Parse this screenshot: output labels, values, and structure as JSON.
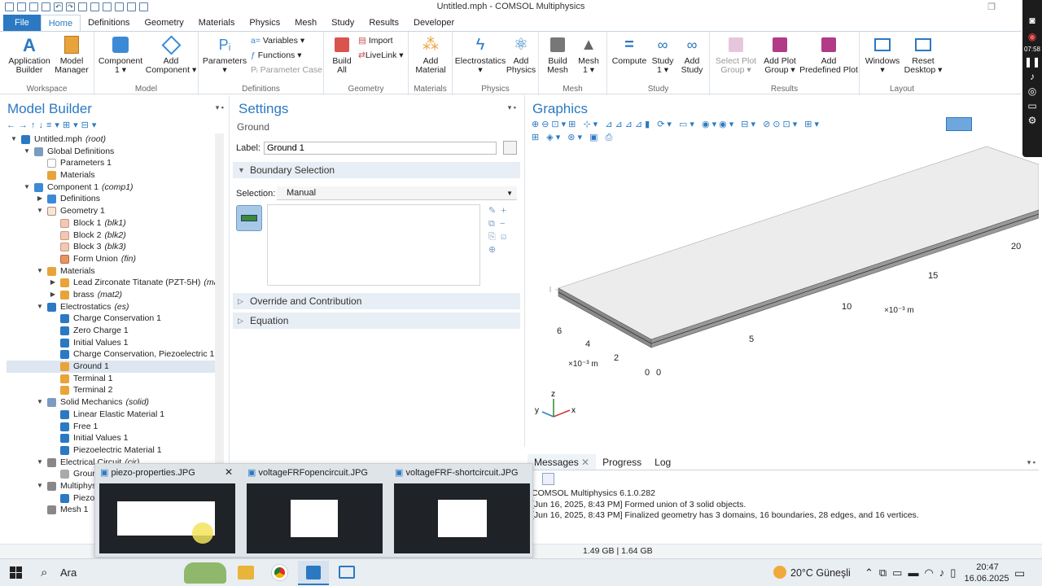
{
  "window": {
    "title": "Untitled.mph - COMSOL Multiphysics"
  },
  "menu": {
    "tabs": [
      "File",
      "Home",
      "Definitions",
      "Geometry",
      "Materials",
      "Physics",
      "Mesh",
      "Study",
      "Results",
      "Developer"
    ]
  },
  "ribbon": {
    "groups": {
      "workspace": "Workspace",
      "model": "Model",
      "definitions": "Definitions",
      "geometry": "Geometry",
      "materials": "Materials",
      "physics": "Physics",
      "mesh": "Mesh",
      "study": "Study",
      "results": "Results",
      "layout": "Layout"
    },
    "buttons": {
      "app_builder_1": "Application",
      "app_builder_2": "Builder",
      "model_manager_1": "Model",
      "model_manager_2": "Manager",
      "component_1": "Component",
      "component_2": "1 ▾",
      "add_component_1": "Add",
      "add_component_2": "Component ▾",
      "parameters_1": "Parameters",
      "parameters_2": "▾",
      "variables": "Variables ▾",
      "functions": "Functions ▾",
      "parameter_case": "Parameter Case",
      "build_all_1": "Build",
      "build_all_2": "All",
      "import": "Import",
      "livelink": "LiveLink ▾",
      "add_material_1": "Add",
      "add_material_2": "Material",
      "electrostatics_1": "Electrostatics",
      "electrostatics_2": "▾",
      "add_physics_1": "Add",
      "add_physics_2": "Physics",
      "build_mesh_1": "Build",
      "build_mesh_2": "Mesh",
      "mesh_1": "Mesh",
      "mesh_2": "1 ▾",
      "compute": "Compute",
      "study_1": "Study",
      "study_2": "1 ▾",
      "add_study_1": "Add",
      "add_study_2": "Study",
      "select_plot_1": "Select Plot",
      "select_plot_2": "Group ▾",
      "add_plot_1": "Add Plot",
      "add_plot_2": "Group ▾",
      "add_predefined_1": "Add",
      "add_predefined_2": "Predefined Plot",
      "windows_1": "Windows",
      "windows_2": "▾",
      "reset_desktop_1": "Reset",
      "reset_desktop_2": "Desktop ▾"
    }
  },
  "model_builder": {
    "title": "Model Builder",
    "tree": [
      {
        "label": "Untitled.mph",
        "tag": "(root)"
      },
      {
        "label": "Global Definitions",
        "tag": ""
      },
      {
        "label": "Parameters 1",
        "tag": ""
      },
      {
        "label": "Materials",
        "tag": ""
      },
      {
        "label": "Component 1",
        "tag": "(comp1)"
      },
      {
        "label": "Definitions",
        "tag": ""
      },
      {
        "label": "Geometry 1",
        "tag": ""
      },
      {
        "label": "Block 1",
        "tag": "(blk1)"
      },
      {
        "label": "Block 2",
        "tag": "(blk2)"
      },
      {
        "label": "Block 3",
        "tag": "(blk3)"
      },
      {
        "label": "Form Union",
        "tag": "(fin)"
      },
      {
        "label": "Materials",
        "tag": ""
      },
      {
        "label": "Lead Zirconate Titanate (PZT-5H)",
        "tag": "(ma"
      },
      {
        "label": "brass",
        "tag": "(mat2)"
      },
      {
        "label": "Electrostatics",
        "tag": "(es)"
      },
      {
        "label": "Charge Conservation 1",
        "tag": ""
      },
      {
        "label": "Zero Charge 1",
        "tag": ""
      },
      {
        "label": "Initial Values 1",
        "tag": ""
      },
      {
        "label": "Charge Conservation, Piezoelectric 1",
        "tag": ""
      },
      {
        "label": "Ground 1",
        "tag": ""
      },
      {
        "label": "Terminal 1",
        "tag": ""
      },
      {
        "label": "Terminal 2",
        "tag": ""
      },
      {
        "label": "Solid Mechanics",
        "tag": "(solid)"
      },
      {
        "label": "Linear Elastic Material 1",
        "tag": ""
      },
      {
        "label": "Free 1",
        "tag": ""
      },
      {
        "label": "Initial Values 1",
        "tag": ""
      },
      {
        "label": "Piezoelectric Material 1",
        "tag": ""
      },
      {
        "label": "Electrical Circuit",
        "tag": "(cir)"
      },
      {
        "label": "Groun",
        "tag": ""
      },
      {
        "label": "Multiphys",
        "tag": ""
      },
      {
        "label": "Piezo",
        "tag": ""
      },
      {
        "label": "Mesh 1",
        "tag": ""
      }
    ]
  },
  "settings": {
    "title": "Settings",
    "subtitle": "Ground",
    "label_caption": "Label:",
    "label_value": "Ground 1",
    "boundary_section": "Boundary Selection",
    "selection_caption": "Selection:",
    "selection_value": "Manual",
    "override_section": "Override and Contribution",
    "equation_section": "Equation"
  },
  "graphics": {
    "title": "Graphics",
    "axis_ticks_long": [
      "5",
      "10",
      "15",
      "20"
    ],
    "axis_ticks_short": [
      "0",
      "2",
      "4",
      "6"
    ],
    "axis_zero2": "0",
    "unit_long": "×10⁻³ m",
    "unit_short": "×10⁻³ m",
    "triad": {
      "x": "x",
      "y": "y",
      "z": "z"
    }
  },
  "messages": {
    "tabs": [
      "Messages",
      "Progress",
      "Log"
    ],
    "lines": [
      "COMSOL Multiphysics 6.1.0.282",
      "[Jun 16, 2025, 8:43 PM] Formed union of 3 solid objects.",
      "[Jun 16, 2025, 8:43 PM] Finalized geometry has 3 domains, 16 boundaries, 28 edges, and 16 vertices."
    ]
  },
  "status": {
    "memory": "1.49 GB | 1.64 GB"
  },
  "thumbnails": [
    {
      "title": "piezo-properties.JPG"
    },
    {
      "title": "voltageFRFopencircuit.JPG"
    },
    {
      "title": "voltageFRF-shortcircuit.JPG"
    }
  ],
  "taskbar": {
    "search": "Ara",
    "weather": "20°C  Güneşli",
    "time": "20:47",
    "date": "16.06.2025"
  },
  "side_widget": {
    "time": "07:58"
  },
  "colors": {
    "accent": "#2b79c2",
    "selection": "#dde6f1",
    "section_bg": "#e8eef5"
  }
}
